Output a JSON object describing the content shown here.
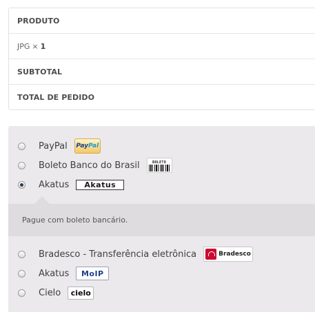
{
  "order": {
    "product_header": "PRODUTO",
    "product_name": "JPG",
    "times": "×",
    "product_qty": "1",
    "subtotal_header": "SUBTOTAL",
    "total_header": "TOTAL DE PEDIDO"
  },
  "payment": {
    "selected": "akatus",
    "methods": [
      {
        "label": "PayPal",
        "logo": "PayPal",
        "checked": false
      },
      {
        "label": "Boleto Banco do Brasil",
        "logo": "BOLETO",
        "checked": false
      },
      {
        "label": "Akatus",
        "logo": "Akatus",
        "checked": true
      },
      {
        "label": "Bradesco - Transferência eletrônica",
        "logo": "Bradesco",
        "checked": false
      },
      {
        "label": "Akatus",
        "logo": "MoIP",
        "checked": false
      },
      {
        "label": "Cielo",
        "logo": "cielo",
        "checked": false
      }
    ],
    "description": "Pague com boleto bancário."
  },
  "colors": {
    "payment_bg": "#ebe9eb",
    "desc_bg": "#dfdcdf",
    "radio_checked": "#2b3a5c",
    "bradesco_red": "#cc092f"
  }
}
